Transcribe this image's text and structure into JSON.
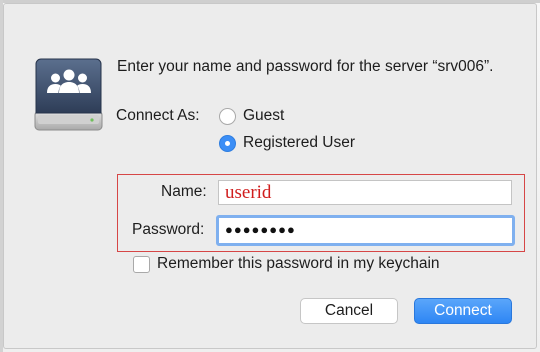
{
  "dialog": {
    "prompt": "Enter your name and password for the server “srv006”.",
    "connect_as_label": "Connect As:",
    "options": [
      {
        "label": "Guest",
        "selected": false
      },
      {
        "label": "Registered User",
        "selected": true
      }
    ],
    "name_label": "Name:",
    "name_value": "userid",
    "password_label": "Password:",
    "password_value": "●●●●●●●●",
    "remember_label": "Remember this password in my keychain",
    "remember_checked": false,
    "cancel_label": "Cancel",
    "connect_label": "Connect",
    "icon": "server-users-icon"
  },
  "colors": {
    "accent": "#3b8ef6",
    "highlight_border": "#d64646",
    "name_text": "#d01d1d"
  }
}
